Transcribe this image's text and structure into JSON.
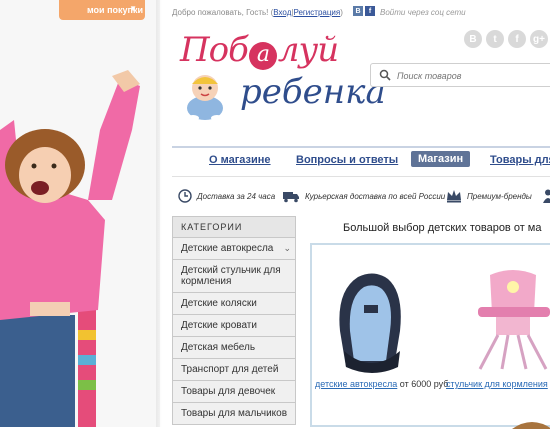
{
  "header": {
    "purchases_label": "мои покупки",
    "purchases_arrow": "▼",
    "welcome_text": "Добро пожаловать, Гость! (",
    "login_link": "Вход",
    "separator": "|",
    "register_link": "Регистрация",
    "close_paren": ")",
    "via_social": "Войти через соц сети",
    "social_small": [
      "В",
      "f"
    ],
    "social_round": [
      "B",
      "t",
      "f",
      "g+"
    ]
  },
  "logo": {
    "top_before": "Поб",
    "top_circle": "а",
    "top_after": "луй",
    "bottom": "ребенка"
  },
  "search": {
    "placeholder": "Поиск товаров"
  },
  "nav": {
    "items": [
      {
        "label": "О магазине"
      },
      {
        "label": "Вопросы и ответы"
      },
      {
        "label": "Магазин",
        "active": true
      },
      {
        "label": "Товары для"
      }
    ]
  },
  "features": [
    {
      "text": "Доставка за 24 часа",
      "icon": "clock-icon"
    },
    {
      "text": "Курьерская доставка по всей России",
      "icon": "truck-icon"
    },
    {
      "text": "Премиум-бренды",
      "icon": "crown-icon"
    }
  ],
  "categories": {
    "header": "КАТЕГОРИИ",
    "items": [
      "Детские автокресла",
      "Детский стульчик для кормления",
      "Детские коляски",
      "Детские кровати",
      "Детская мебель",
      "Транспорт для детей",
      "Товары для девочек",
      "Товары для мальчиков"
    ]
  },
  "promo": {
    "title": "Большой выбор детских товаров от ма",
    "products": [
      {
        "link": "детские автокресла",
        "price": "от 6000 руб"
      },
      {
        "link": "стульчик для кормления",
        "price": ""
      }
    ]
  },
  "colors": {
    "accent_orange": "#f4a66a",
    "brand_pink": "#d6335f",
    "brand_blue": "#2f4d8c",
    "nav_active": "#5f7397"
  }
}
